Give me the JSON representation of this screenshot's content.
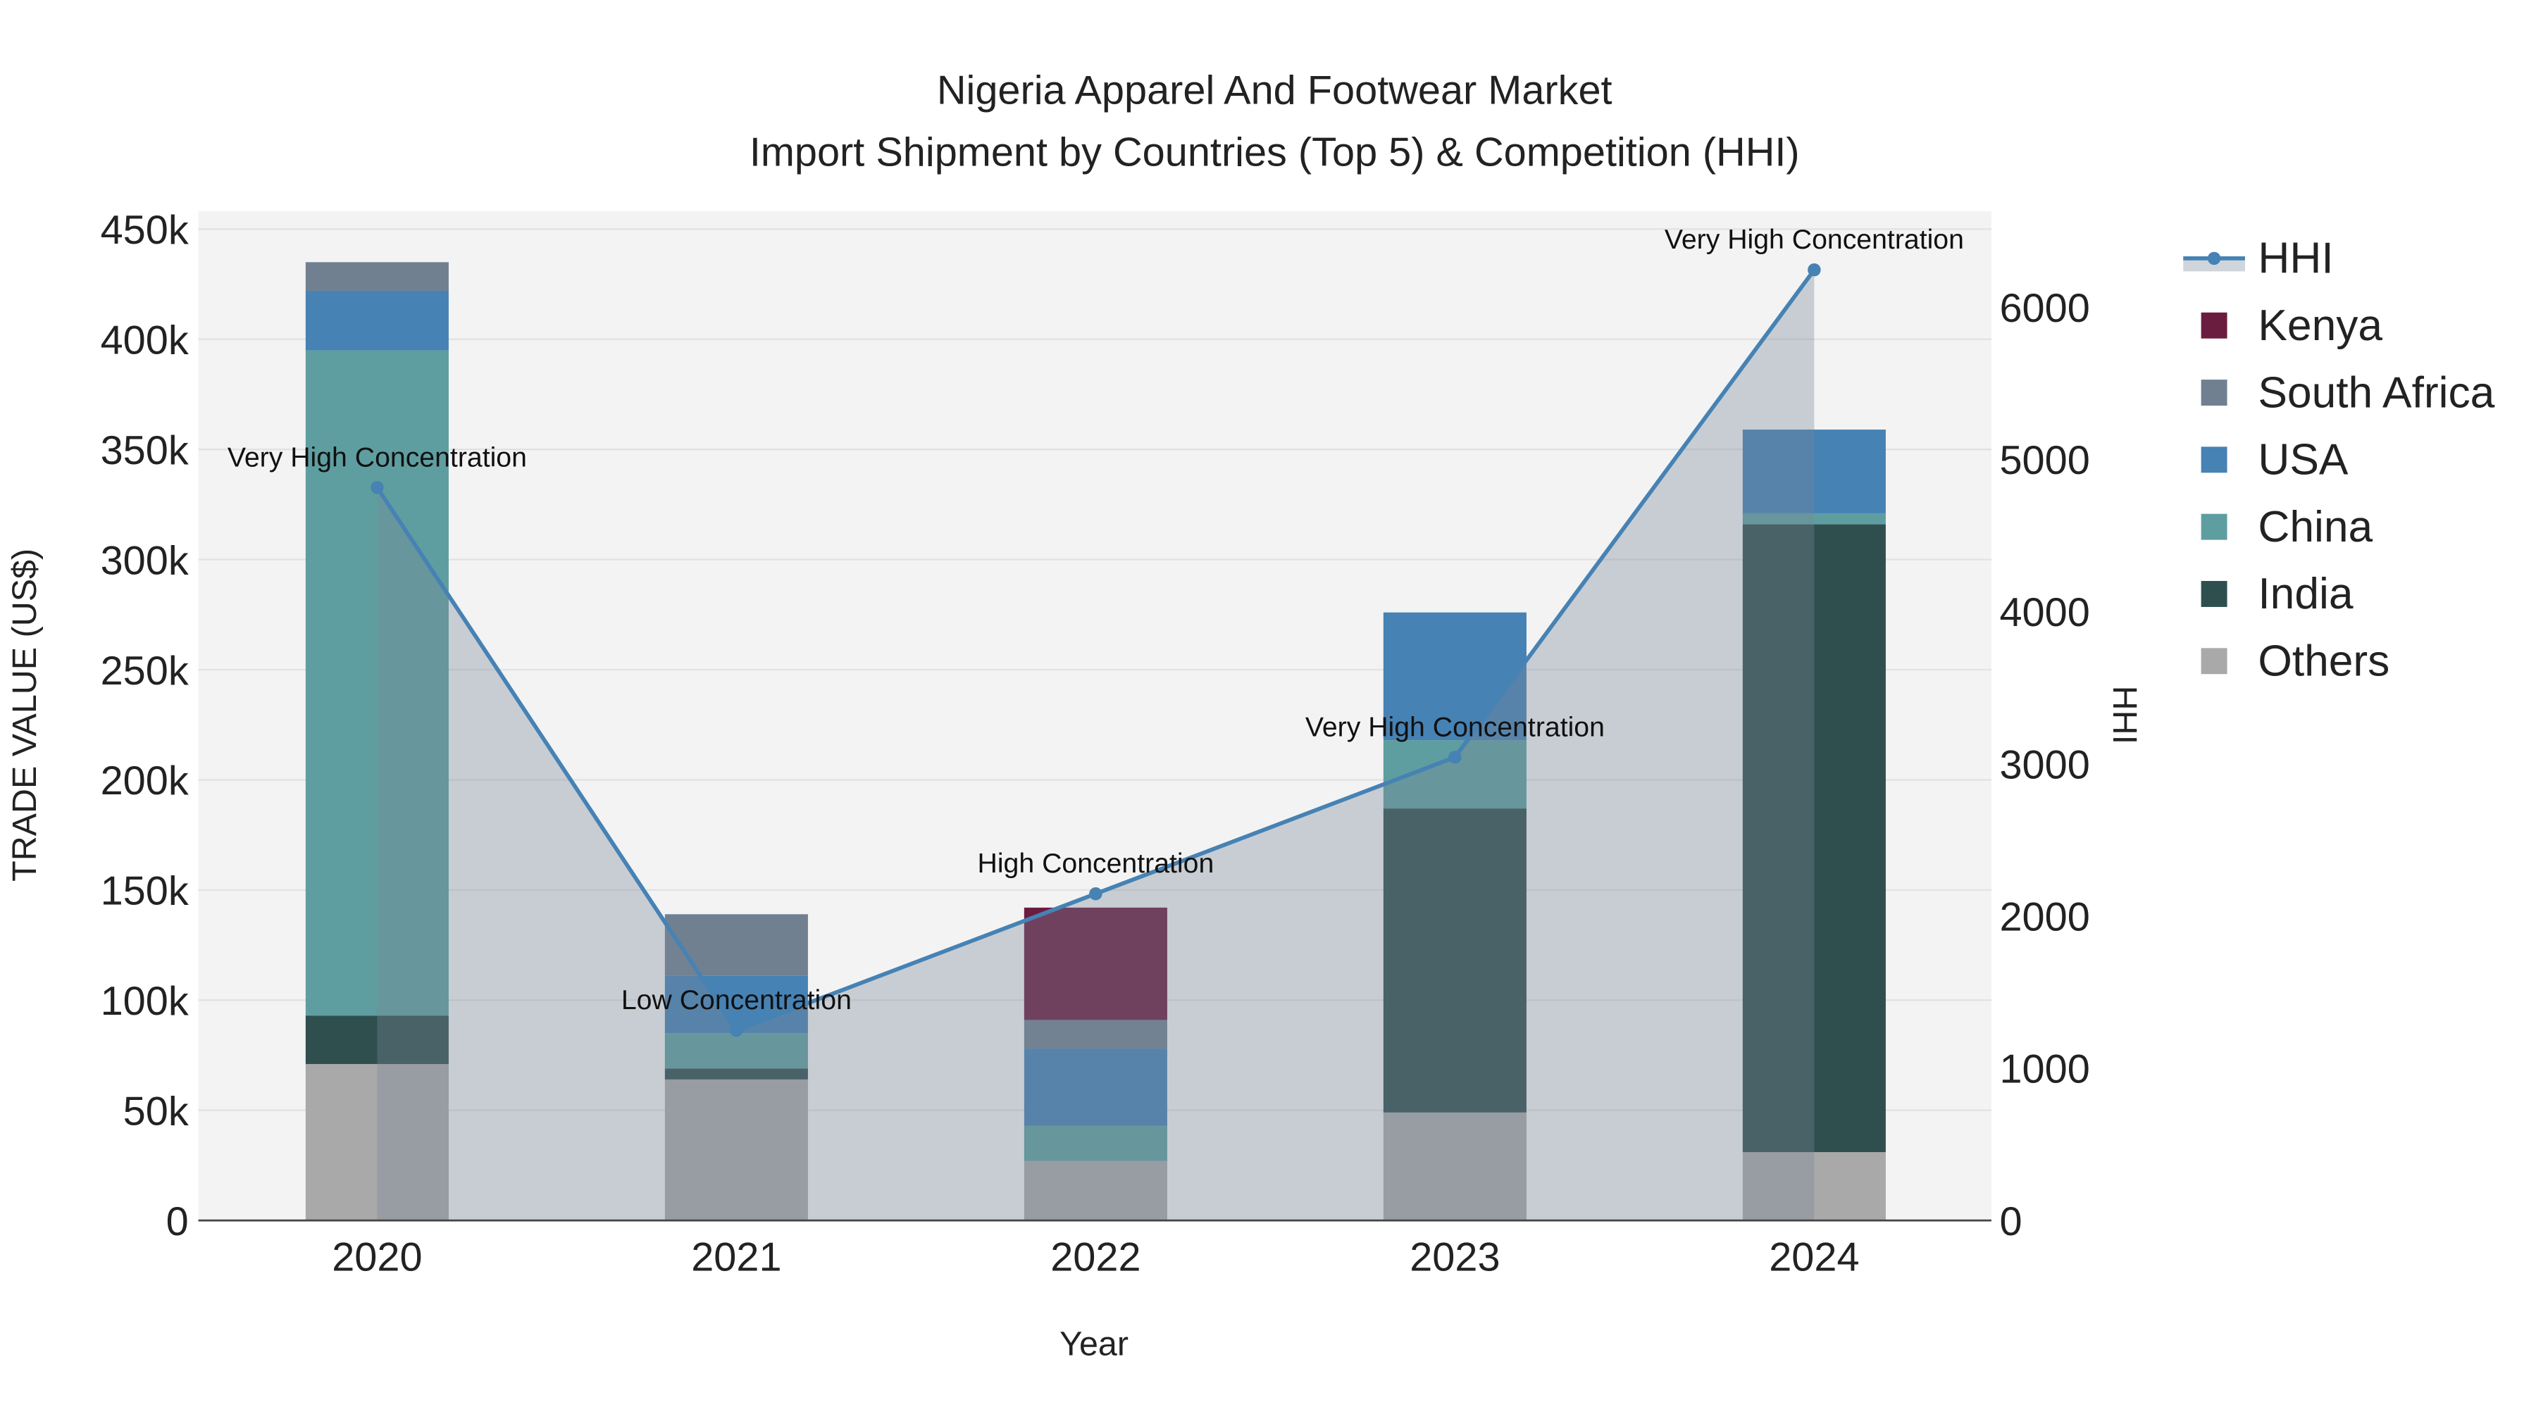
{
  "chart_data": {
    "type": "bar",
    "title_line1": "Nigeria Apparel And Footwear Market",
    "title_line2": "Import Shipment by Countries (Top 5) & Competition (HHI)",
    "xlabel": "Year",
    "ylabel": "TRADE VALUE (US$)",
    "y2label": "HHI",
    "categories": [
      "2020",
      "2021",
      "2022",
      "2023",
      "2024"
    ],
    "ylim": [
      0,
      450000
    ],
    "y_ticks": [
      {
        "v": 0,
        "label": "0"
      },
      {
        "v": 50000,
        "label": "50k"
      },
      {
        "v": 100000,
        "label": "100k"
      },
      {
        "v": 150000,
        "label": "150k"
      },
      {
        "v": 200000,
        "label": "200k"
      },
      {
        "v": 250000,
        "label": "250k"
      },
      {
        "v": 300000,
        "label": "300k"
      },
      {
        "v": 350000,
        "label": "350k"
      },
      {
        "v": 400000,
        "label": "400k"
      },
      {
        "v": 450000,
        "label": "450k"
      }
    ],
    "y2lim": [
      0,
      6600
    ],
    "y2_ticks": [
      {
        "v": 0,
        "label": "0"
      },
      {
        "v": 1000,
        "label": "1000"
      },
      {
        "v": 2000,
        "label": "2000"
      },
      {
        "v": 3000,
        "label": "3000"
      },
      {
        "v": 4000,
        "label": "4000"
      },
      {
        "v": 5000,
        "label": "5000"
      },
      {
        "v": 6000,
        "label": "6000"
      }
    ],
    "series": [
      {
        "name": "Others",
        "color": "#a9a9a9",
        "values": [
          71000,
          64000,
          27000,
          49000,
          31000
        ]
      },
      {
        "name": "India",
        "color": "#2f4f4f",
        "values": [
          22000,
          5000,
          0,
          138000,
          285000
        ]
      },
      {
        "name": "China",
        "color": "#5f9ea0",
        "values": [
          302000,
          16000,
          16000,
          31000,
          5000
        ]
      },
      {
        "name": "USA",
        "color": "#4682b4",
        "values": [
          27000,
          26000,
          35000,
          58000,
          38000
        ]
      },
      {
        "name": "South Africa",
        "color": "#708090",
        "values": [
          13000,
          28000,
          13000,
          0,
          0
        ]
      },
      {
        "name": "Kenya",
        "color": "#6b1d3f",
        "values": [
          0,
          0,
          51000,
          0,
          0
        ]
      }
    ],
    "hhi": {
      "name": "HHI",
      "color": "#4682b4",
      "area_color": "#778899",
      "values": [
        4815,
        1249,
        2146,
        3043,
        6245
      ],
      "annotations": [
        "Very High Concentration",
        "Low Concentration",
        "High Concentration",
        "Very High Concentration",
        "Very High Concentration"
      ]
    },
    "legend": [
      "HHI",
      "Kenya",
      "South Africa",
      "USA",
      "China",
      "India",
      "Others"
    ],
    "legend_position": "right",
    "grid": true
  }
}
